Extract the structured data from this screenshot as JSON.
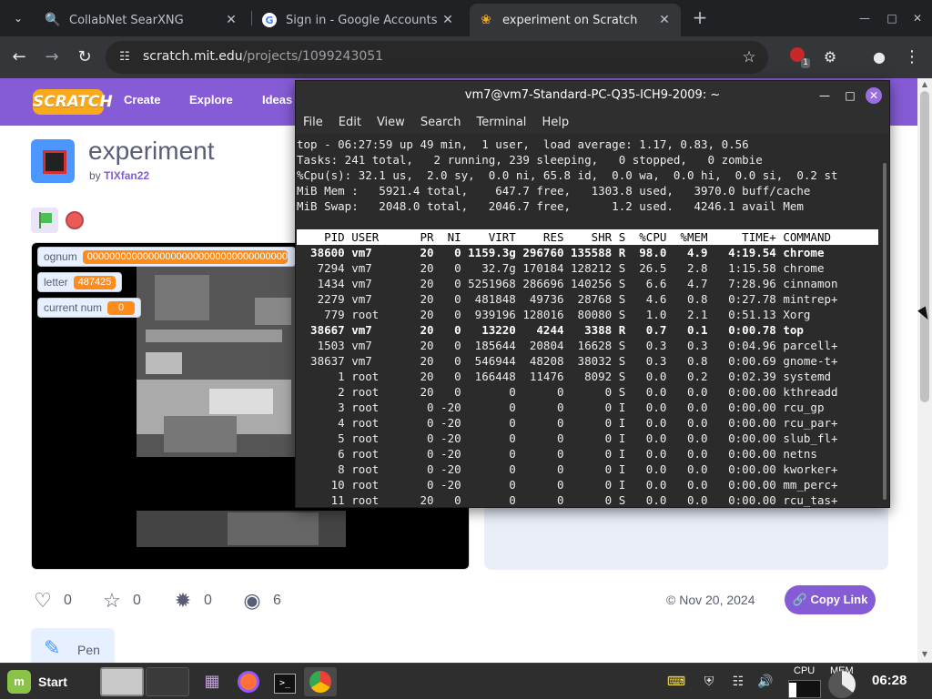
{
  "browser": {
    "tabs": [
      {
        "title": "CollabNet SearXNG",
        "icon": "search-icon",
        "active": false
      },
      {
        "title": "Sign in - Google Accounts",
        "icon": "google-icon",
        "active": false
      },
      {
        "title": "experiment on Scratch",
        "icon": "scratch-icon",
        "active": true
      }
    ],
    "url_host": "scratch.mit.edu",
    "url_path": "/projects/1099243051",
    "extension_badge": "1"
  },
  "scratch": {
    "logo": "SCRATCH",
    "nav": [
      "Create",
      "Explore",
      "Ideas"
    ],
    "project_title": "experiment",
    "by_label": "by",
    "author": "TIXfan22",
    "monitors": [
      {
        "label": "ognum",
        "value": "0000000000000000000000000000000000000"
      },
      {
        "label": "letter",
        "value": "487425"
      },
      {
        "label": "current num",
        "value": "0"
      }
    ],
    "stats": {
      "loves": "0",
      "favorites": "0",
      "remixes": "0",
      "views": "6"
    },
    "date": "Nov 20, 2024",
    "copy_link": "Copy Link",
    "extension": "Pen"
  },
  "terminal": {
    "title": "vm7@vm7-Standard-PC-Q35-ICH9-2009: ~",
    "menu": [
      "File",
      "Edit",
      "View",
      "Search",
      "Terminal",
      "Help"
    ],
    "summary": [
      "top - 06:27:59 up 49 min,  1 user,  load average: 1.17, 0.83, 0.56",
      "Tasks: 241 total,   2 running, 239 sleeping,   0 stopped,   0 zombie",
      "%Cpu(s): 32.1 us,  2.0 sy,  0.0 ni, 65.8 id,  0.0 wa,  0.0 hi,  0.0 si,  0.2 st",
      "MiB Mem :   5921.4 total,    647.7 free,   1303.8 used,   3970.0 buff/cache",
      "MiB Swap:   2048.0 total,   2046.7 free,      1.2 used.   4246.1 avail Mem"
    ],
    "header": "    PID USER      PR  NI    VIRT    RES    SHR S  %CPU  %MEM     TIME+ COMMAND",
    "processes": [
      {
        "line": "  38600 vm7       20   0 1159.3g 296760 135588 R  98.0   4.9   4:19.54 chrome",
        "bold": true
      },
      {
        "line": "   7294 vm7       20   0   32.7g 170184 128212 S  26.5   2.8   1:15.58 chrome",
        "bold": false
      },
      {
        "line": "   1434 vm7       20   0 5251968 286696 140256 S   6.6   4.7   7:28.96 cinnamon",
        "bold": false
      },
      {
        "line": "   2279 vm7       20   0  481848  49736  28768 S   4.6   0.8   0:27.78 mintrep+",
        "bold": false
      },
      {
        "line": "    779 root      20   0  939196 128016  80080 S   1.0   2.1   0:51.13 Xorg",
        "bold": false
      },
      {
        "line": "  38667 vm7       20   0   13220   4244   3388 R   0.7   0.1   0:00.78 top",
        "bold": true
      },
      {
        "line": "   1503 vm7       20   0  185644  20804  16628 S   0.3   0.3   0:04.96 parcell+",
        "bold": false
      },
      {
        "line": "  38637 vm7       20   0  546944  48208  38032 S   0.3   0.8   0:00.69 gnome-t+",
        "bold": false
      },
      {
        "line": "      1 root      20   0  166448  11476   8092 S   0.0   0.2   0:02.39 systemd",
        "bold": false
      },
      {
        "line": "      2 root      20   0       0      0      0 S   0.0   0.0   0:00.00 kthreadd",
        "bold": false
      },
      {
        "line": "      3 root       0 -20       0      0      0 I   0.0   0.0   0:00.00 rcu_gp",
        "bold": false
      },
      {
        "line": "      4 root       0 -20       0      0      0 I   0.0   0.0   0:00.00 rcu_par+",
        "bold": false
      },
      {
        "line": "      5 root       0 -20       0      0      0 I   0.0   0.0   0:00.00 slub_fl+",
        "bold": false
      },
      {
        "line": "      6 root       0 -20       0      0      0 I   0.0   0.0   0:00.00 netns",
        "bold": false
      },
      {
        "line": "      8 root       0 -20       0      0      0 I   0.0   0.0   0:00.00 kworker+",
        "bold": false
      },
      {
        "line": "     10 root       0 -20       0      0      0 I   0.0   0.0   0:00.00 mm_perc+",
        "bold": false
      },
      {
        "line": "     11 root      20   0       0      0      0 S   0.0   0.0   0:00.00 rcu_tas+",
        "bold": false
      }
    ]
  },
  "taskbar": {
    "start": "Start",
    "cpu_label": "CPU",
    "mem_label": "MEM",
    "clock": "06:28"
  },
  "colors": {
    "scratch_purple": "#855cd6",
    "scratch_orange": "#ff8c1a",
    "chrome_dark": "#202124"
  }
}
